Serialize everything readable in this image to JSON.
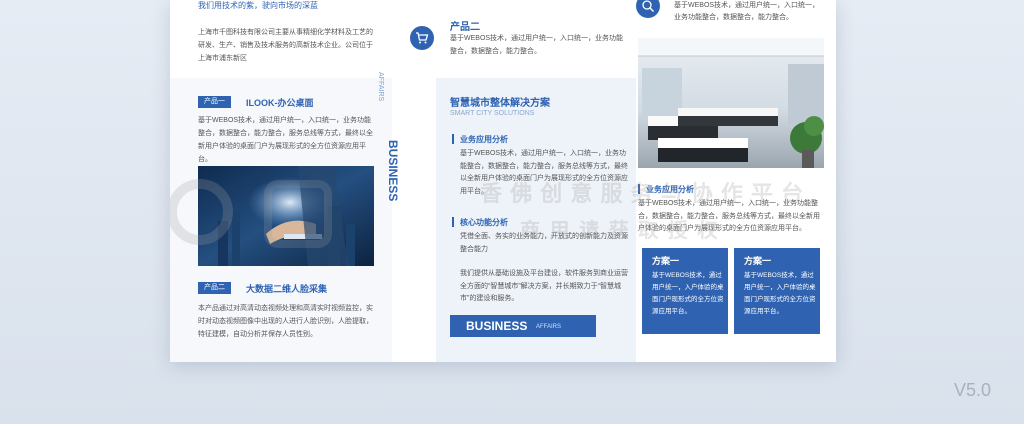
{
  "panel1": {
    "top_subtitle": "我们用技术的紫，驶向市场的深蓝",
    "company_text": "上海市千图科技有限公司主要从事精细化学材料及工艺的研发、生产、销售及技术服务的高新技术企业。公司位于上海市浦东新区",
    "product1_tag": "产品一",
    "product1_title": "ILOOK-办公桌面",
    "product1_text": "基于WEBOS技术，通过用户统一，入口统一，业务功能整合，数据整合，能力整合，服务总线等方式，最终以全新用户体验的桌面门户为展现形式的全方位资源应用平台。",
    "product2_tag": "产品二",
    "product2_title": "大数据二维人脸采集",
    "product2_text": "本产品通过对高清动态视频处理和高清实时视频监控，实时对动态视频图像中出现的人进行人脸识别，人脸提取，特征建模，自动分析并保存人员性别。"
  },
  "spine": {
    "title": "BUSINESS",
    "sub": "AFFAIRS"
  },
  "panel3": {
    "product2_heading": "产品二",
    "product2_text": "基于WEBOS技术，通过用户统一，入口统一，业务功能整合，数据整合，能力整合。",
    "solution_title": "智慧城市整体解决方案",
    "solution_sub": "SMART CITY SOLUTIONS",
    "sec1_title": "业务应用分析",
    "sec1_text": "基于WEBOS技术，通过用户统一，入口统一，业务功能整合，数据整合，能力整合，服务总线等方式，最终以全新用户体验的桌面门户为展现形式的全方位资源应用平台。",
    "sec2_title": "核心功能分析",
    "sec2_text": "凭借全面、务实的业务能力，开放式的创新能力及资源整合能力",
    "closing_text": "我们提供从基础设施及平台建设，软件服务到商业运营全方面的“智慧城市”解决方案，并长期致力于“智慧城市”的建设和服务。",
    "banner_main": "BUSINESS",
    "banner_sub": "AFFAIRS"
  },
  "panel4": {
    "top_text": "基于WEBOS技术，通过用户统一，入口统一，业务功能整合，数据整合，能力整合。",
    "analysis_title": "业务应用分析",
    "analysis_text": "基于WEBOS技术，通过用户统一，入口统一，业务功能整合，数据整合，能力整合，服务总线等方式，最终以全新用户体验的桌面门户为展现形式的全方位资源应用平台。",
    "card1_title": "方案一",
    "card1_text": "基于WEBOS技术，通过用户统一，入户体验的桌面门户现形式的全方位资源应用平台。",
    "card2_title": "方案一",
    "card2_text": "基于WEBOS技术，通过用户统一，入户体验的桌面门户现形式的全方位资源应用平台。"
  },
  "version": "V5.0",
  "watermark": {
    "line1": "香 佛 创 意 服 务 与 协 作 平 台",
    "line2": "商 用 请 获 取 授 权"
  },
  "colors": {
    "brand": "#2f63b2",
    "panel_bg": "#eef3fa"
  },
  "icons": [
    "cart-icon",
    "search-globe-icon"
  ]
}
